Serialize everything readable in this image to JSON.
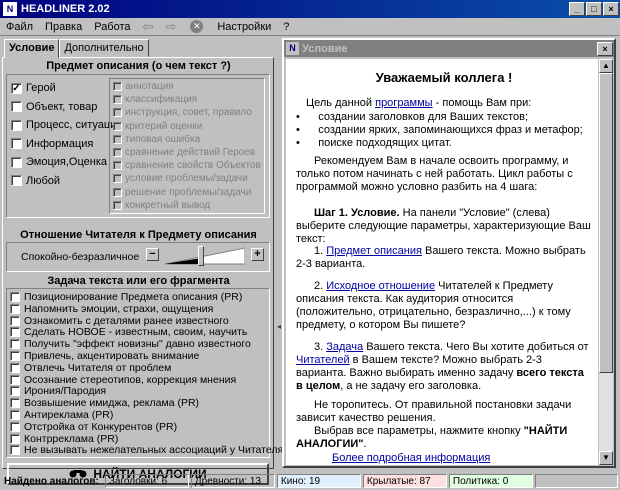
{
  "window": {
    "title": "HEADLINER 2.02"
  },
  "menu": {
    "file": "Файл",
    "edit": "Правка",
    "work": "Работа",
    "settings": "Настройки",
    "help": "?"
  },
  "tabs": {
    "condition": "Условие",
    "additional": "Дополнительно"
  },
  "subject": {
    "heading": "Предмет описания (о чем текст ?)",
    "items": [
      "Герой",
      "Объект, товар",
      "Процесс, ситуация",
      "Информация",
      "Эмоция,Оценка",
      "Любой"
    ],
    "checked": [
      true,
      false,
      false,
      false,
      false,
      false
    ]
  },
  "aspects": [
    "аннотация",
    "классификация",
    "инструкция, совет, правило",
    "критерий оценки",
    "типовая ошибка",
    "сравнение действий Героев",
    "сравнение свойств Объектов",
    "условие проблемы/задачи",
    "решение проблемы/задачи",
    "конкретный вывод"
  ],
  "attitude": {
    "heading": "Отношение Читателя к Предмету описания",
    "label": "Спокойно-безразличное",
    "level_percent": 45
  },
  "task": {
    "heading": "Задача текста или его фрагмента",
    "items": [
      "Позиционирование Предмета описания (PR)",
      "Напомнить эмоции, страхи, ощущения",
      "Ознакомить с деталями ранее известного",
      "Сделать НОВОЕ - известным, своим, научить",
      "Получить \"эффект новизны\" давно известного",
      "Привлечь, акцентировать внимание",
      "Отвлечь Читателя от проблем",
      "Осознание стереотипов, коррекция мнения",
      "Ирония/Пародия",
      "Возвышение имиджа, реклама (PR)",
      "Антиреклама (PR)",
      "Отстройка от Конкурентов (PR)",
      "Контрреклама (PR)",
      "Не вызывать нежелательных ассоциаций у Читателя"
    ]
  },
  "find_button": "НАЙТИ АНАЛОГИИ",
  "right": {
    "title": "Условие",
    "greeting": "Уважаемый коллега !",
    "intro_a": "Цель данной ",
    "intro_link": "программы",
    "intro_b": " - помощь Вам при:",
    "bullets": [
      "создании заголовков для Ваших текстов;",
      "создании ярких, запоминающихся фраз и метафор;",
      "поиске подходящих цитат."
    ],
    "recommend": "Рекомендуем Вам в начале освоить программу, и только потом начинать с ней работать. Цикл работы с программой можно условно разбить на 4 шага:",
    "step1_bold": "Шаг 1. Условие.",
    "step1_rest": " На панели \"Условие\" (слева) выберите следующие параметры, характеризующие Ваш текст:",
    "p1_num": "1. ",
    "p1_link": "Предмет описания",
    "p1_rest": " Вашего текста. Можно выбрать 2-3 варианта.",
    "p2_num": "2. ",
    "p2_link": "Исходное отношение",
    "p2_rest": " Читателей к Предмету описания текста. Как аудитория относится (положительно, отрицательно, безразлично,...) к тому предмету, о котором Вы пишете?",
    "p3_num": "3. ",
    "p3_link": "Задача",
    "p3_mid1": " Вашего текста. Чего Вы хотите добиться от ",
    "p3_link2": "Читателей",
    "p3_mid2": " в Вашем тексте? Можно выбрать 2-3 варианта. Важно выбирать именно задачу ",
    "p3_bold": "всего текста в целом",
    "p3_end": ", а не задачу его заголовка.",
    "hurry": "Не торопитесь. От правильной постановки задачи зависит качество решения.",
    "choose_a": "Выбрав все параметры, нажмите кнопку ",
    "choose_b": "\"НАЙТИ АНАЛОГИИ\"",
    "choose_c": ".",
    "more_link": "Более подробная информация"
  },
  "status": {
    "found": "Найдено аналогов:",
    "headlines": "Заголовки: 6",
    "ancient": "Древности: 13",
    "cinema": "Кино: 19",
    "catch": "Крылатые: 87",
    "politics": "Политика: 0"
  },
  "colors": {
    "title_bg": "#00007f",
    "face": "#c0c0c0",
    "link": "#0000a0",
    "status_catch": "#ffe0e0",
    "status_politics": "#e0ffe0",
    "status_cinema": "#e0f0ff"
  }
}
